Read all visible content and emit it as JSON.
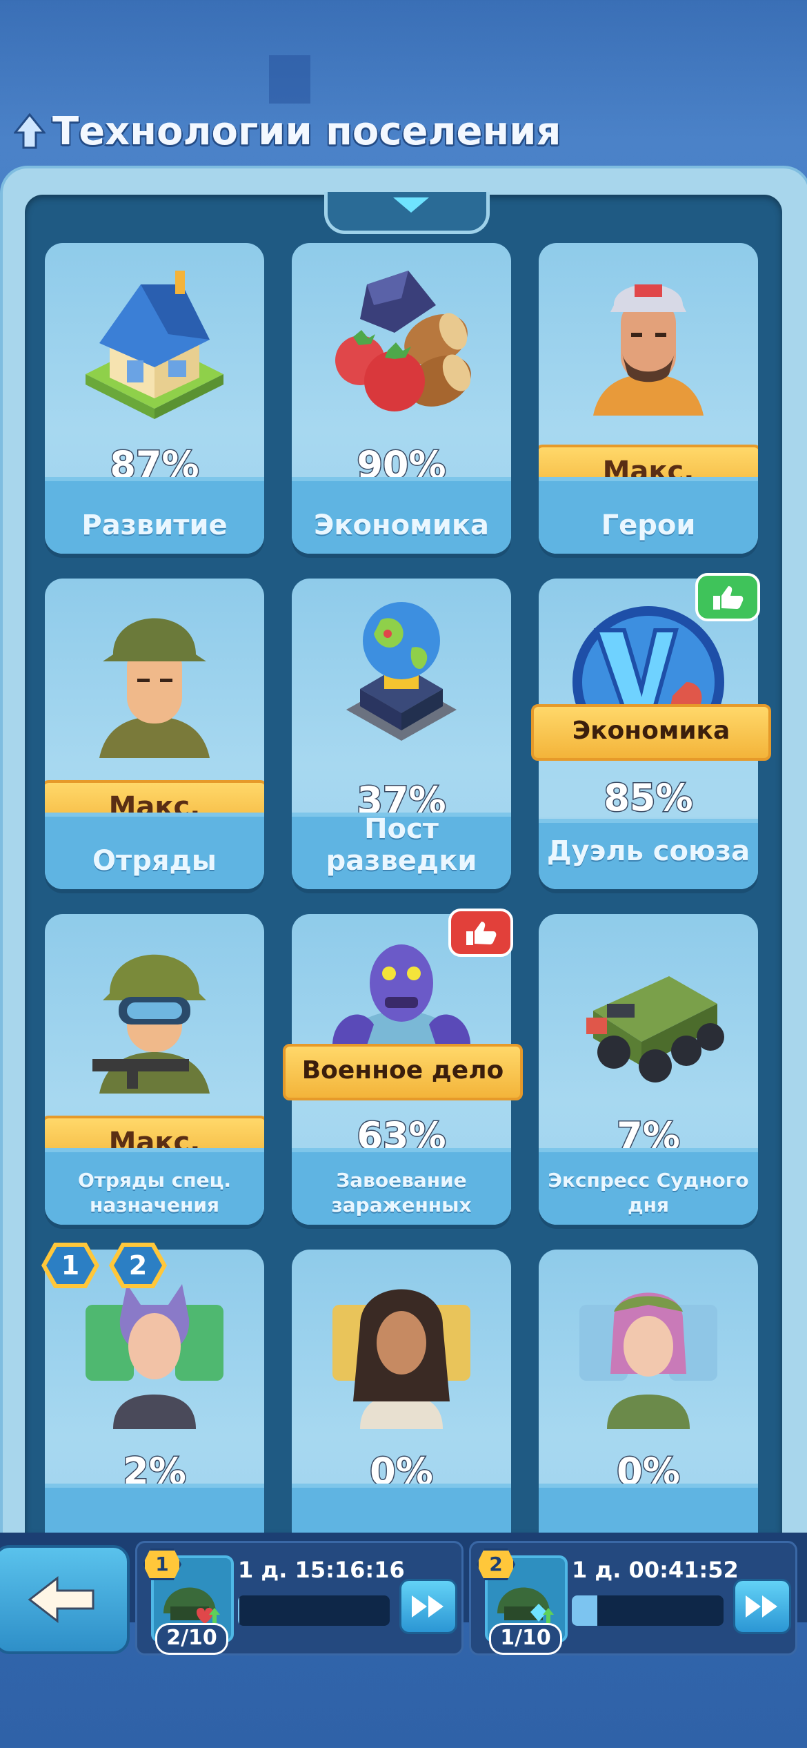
{
  "header": {
    "title": "Технологии поселения",
    "icon": "tree-icon"
  },
  "cards": [
    {
      "name": "Развитие",
      "percent": "87%",
      "art": "house-icon"
    },
    {
      "name": "Экономика",
      "percent": "90%",
      "art": "resources-icon"
    },
    {
      "name": "Герои",
      "max_label": "Макс.",
      "art": "hero-portrait"
    },
    {
      "name": "Отряды",
      "max_label": "Макс.",
      "art": "soldier-portrait"
    },
    {
      "name": "Пост разведки",
      "percent": "37%",
      "art": "globe-outpost-icon"
    },
    {
      "name": "Дуэль союза",
      "percent": "85%",
      "ribbon": "Экономика",
      "art": "vs-duel-icon",
      "recommended": true,
      "recommended_color": "#3fc35a"
    },
    {
      "name": "Отряды спец. назначения",
      "max_label": "Макс.",
      "art": "special-forces-portrait"
    },
    {
      "name": "Завоевание зараженных",
      "percent": "63%",
      "ribbon": "Военное дело",
      "art": "zombie-portrait",
      "recommended": true,
      "recommended_color": "#e2403a"
    },
    {
      "name": "Экспресс Судного дня",
      "percent": "7%",
      "art": "armored-truck-icon"
    },
    {
      "name": "",
      "percent": "2%",
      "art": "heroine-cat-ears-portrait",
      "badges": [
        "1",
        "2"
      ]
    },
    {
      "name": "",
      "percent": "0%",
      "art": "heroine-dark-hair-portrait"
    },
    {
      "name": "",
      "percent": "0%",
      "art": "heroine-pink-hair-portrait"
    }
  ],
  "bottom": {
    "back_icon": "back-arrow-icon",
    "queues": [
      {
        "level": "1",
        "timer": "1 д. 15:16:16",
        "count": "2/10",
        "progress": 0.01
      },
      {
        "level": "2",
        "timer": "1 д. 00:41:52",
        "count": "1/10",
        "progress": 0.17
      }
    ]
  }
}
